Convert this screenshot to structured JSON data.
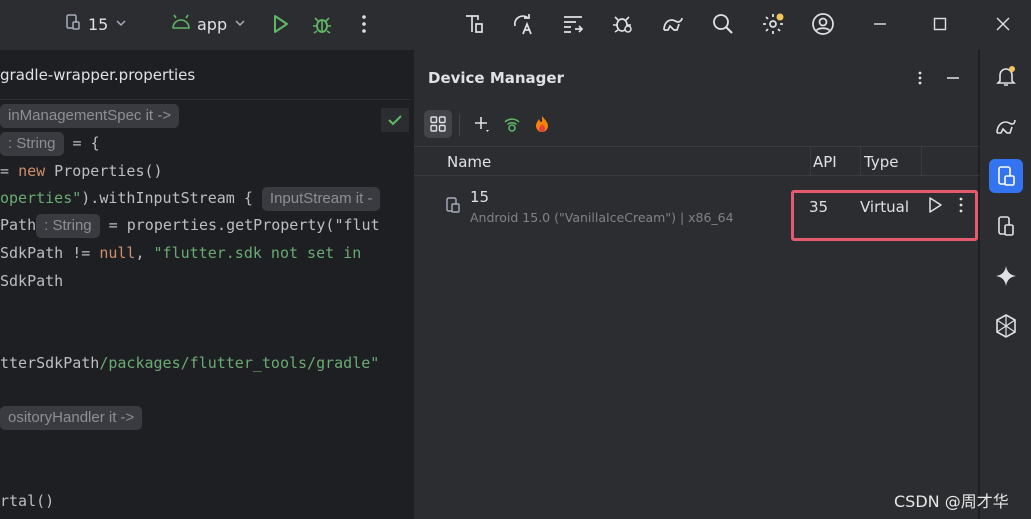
{
  "titlebar": {
    "device_selector": "15",
    "run_config": "app",
    "colors": {
      "run": "#5fb865",
      "debug": "#5fb865",
      "android": "#5fb865",
      "notification_dot": "#f2c55c"
    }
  },
  "editor": {
    "tab_title": "gradle-wrapper.properties",
    "lines": [
      {
        "hint": "inManagementSpec it ->"
      },
      {
        "hint": ": String",
        "code": " = {"
      },
      {
        "code_pre": " = ",
        "kw": "new",
        "code": " Properties()"
      },
      {
        "str": "operties\"",
        "code": ").withInputStream {",
        "hint": "InputStream it -"
      },
      {
        "code_pre": "Path",
        "hint": ": String",
        "code": " = properties.getProperty(\"flut"
      },
      {
        "code_pre": "SdkPath != ",
        "kw": "null",
        "code": ", ",
        "str": "\"flutter.sdk not set in"
      },
      {
        "code": "SdkPath"
      },
      {
        "code": "tterSdkPath",
        "path": "/packages/flutter_tools/gradle\""
      },
      {
        "hint": "ositoryHandler it ->"
      },
      {
        "code": "rtal()"
      }
    ]
  },
  "device_manager": {
    "title": "Device Manager",
    "columns": {
      "name": "Name",
      "api": "API",
      "type": "Type"
    },
    "devices": [
      {
        "name": "15",
        "subtitle": "Android 15.0 (\"VanillaIceCream\") | x86_64",
        "api": "35",
        "type": "Virtual"
      }
    ]
  },
  "watermark": "CSDN @周才华",
  "icons": {
    "tool_strip": [
      "bell-icon",
      "gradle-elephant-icon",
      "device-manager-icon",
      "device-mirroring-icon",
      "gemini-sparkle-icon",
      "kotlin-multiplatform-icon"
    ],
    "accent": "#3574f0",
    "highlight_box": "#e45a6e"
  }
}
